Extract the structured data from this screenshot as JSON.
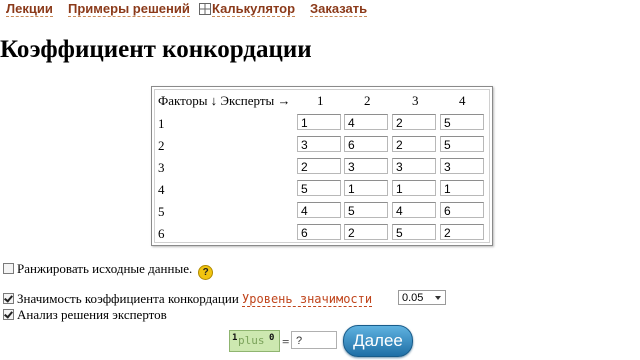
{
  "nav": {
    "lectures": "Лекции",
    "examples": "Примеры решений",
    "calculator": "Калькулятор",
    "order": "Заказать"
  },
  "page_title": "Коэффициент конкордации",
  "matrix": {
    "corner_label": "Факторы ↓ Эксперты →",
    "experts": [
      "1",
      "2",
      "3",
      "4"
    ],
    "factors": [
      "1",
      "2",
      "3",
      "4",
      "5",
      "6"
    ],
    "values": [
      [
        "1",
        "4",
        "2",
        "5"
      ],
      [
        "3",
        "6",
        "2",
        "5"
      ],
      [
        "2",
        "3",
        "3",
        "3"
      ],
      [
        "5",
        "1",
        "1",
        "1"
      ],
      [
        "4",
        "5",
        "4",
        "6"
      ],
      [
        "6",
        "2",
        "5",
        "2"
      ]
    ]
  },
  "options": {
    "rank_label": "Ранжировать исходные данные.",
    "rank_checked": false,
    "significance_label": "Значимость коэффициента конкордации",
    "significance_checked": true,
    "level_link": "Уровень значимости",
    "level_value": "0.05",
    "analysis_label": "Анализ решения экспертов",
    "analysis_checked": true
  },
  "captcha": {
    "left": "1",
    "word": "plus",
    "right": "0",
    "equals": "=",
    "answer_placeholder": "?"
  },
  "submit_label": "Далее",
  "colors": {
    "nav_link": "#8b3a1a",
    "significance_link": "#c0451c",
    "submit_bg": "#2a7fb8",
    "captcha_bg": "#cde8b0"
  }
}
